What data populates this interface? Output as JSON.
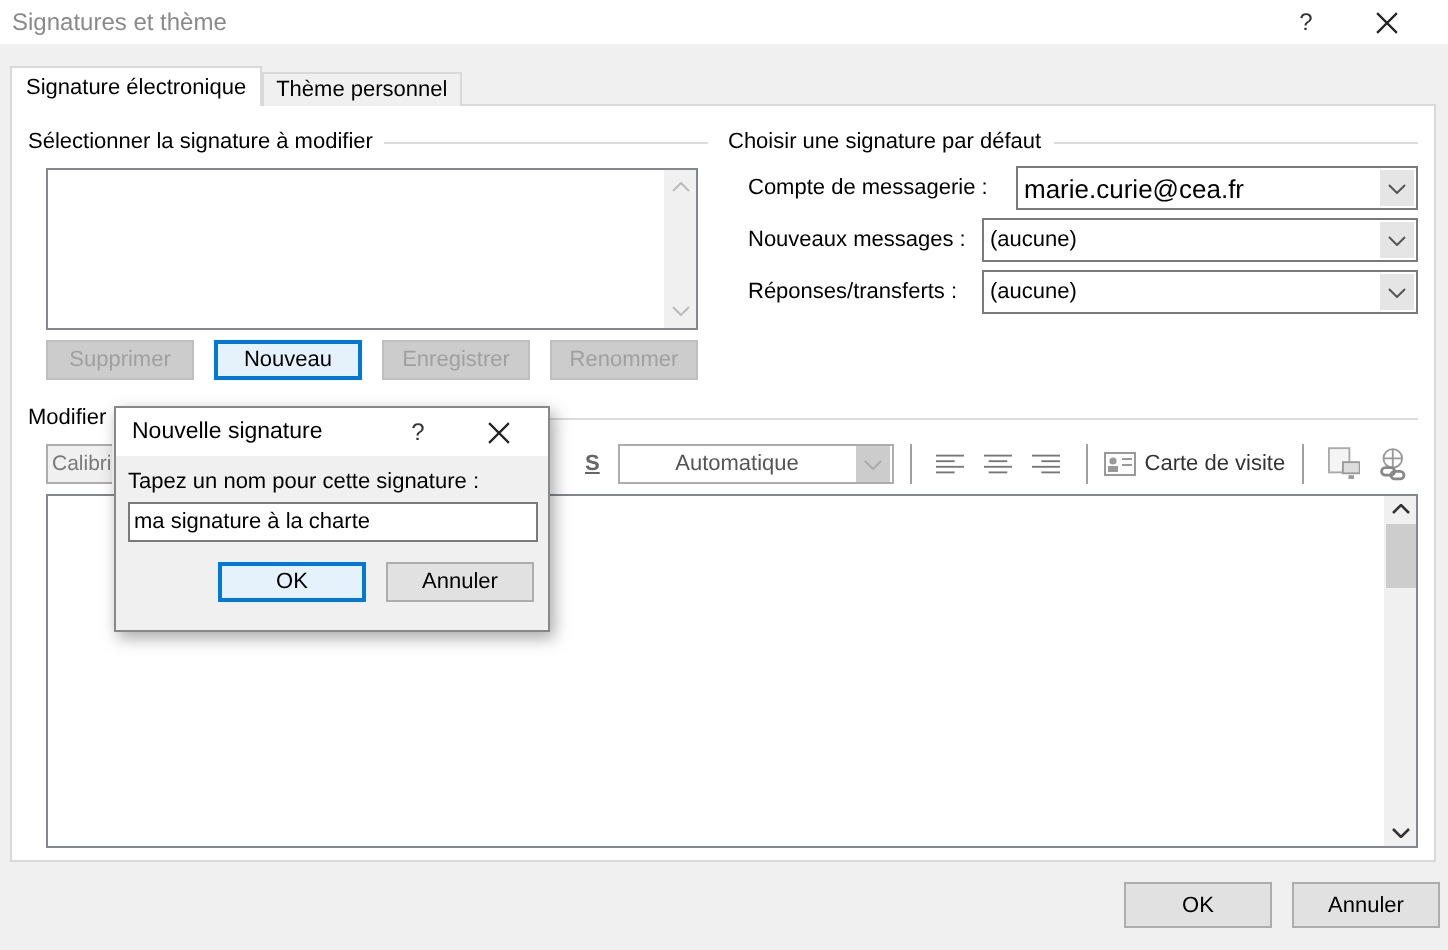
{
  "window": {
    "title": "Signatures et thème",
    "help": "?"
  },
  "tabs": [
    {
      "label": "Signature électronique",
      "selected": true
    },
    {
      "label": "Thème personnel",
      "selected": false
    }
  ],
  "select_signature": {
    "heading": "Sélectionner la signature à modifier",
    "buttons": [
      {
        "label": "Supprimer",
        "disabled": true,
        "focused": false
      },
      {
        "label": "Nouveau",
        "disabled": false,
        "focused": true
      },
      {
        "label": "Enregistrer",
        "disabled": true,
        "focused": false
      },
      {
        "label": "Renommer",
        "disabled": true,
        "focused": false
      }
    ]
  },
  "default_signature": {
    "heading": "Choisir une signature par défaut",
    "fields": [
      {
        "label": "Compte de messagerie :",
        "value": "marie.curie@cea.fr",
        "kind": "account"
      },
      {
        "label": "Nouveaux messages :",
        "value": "(aucune)",
        "kind": "signature"
      },
      {
        "label": "Réponses/transferts :",
        "value": "(aucune)",
        "kind": "signature"
      }
    ]
  },
  "editor": {
    "heading": "Modifier",
    "font": "Calibri",
    "underline": "S",
    "font_color": "Automatique",
    "business_card": "Carte de visite"
  },
  "dialog": {
    "title": "Nouvelle signature",
    "help": "?",
    "prompt": "Tapez un nom pour cette signature :",
    "value": "ma signature à la charte",
    "buttons": [
      {
        "label": "OK",
        "focused": true
      },
      {
        "label": "Annuler",
        "focused": false
      }
    ]
  },
  "buttons": [
    {
      "label": "OK"
    },
    {
      "label": "Annuler"
    }
  ]
}
